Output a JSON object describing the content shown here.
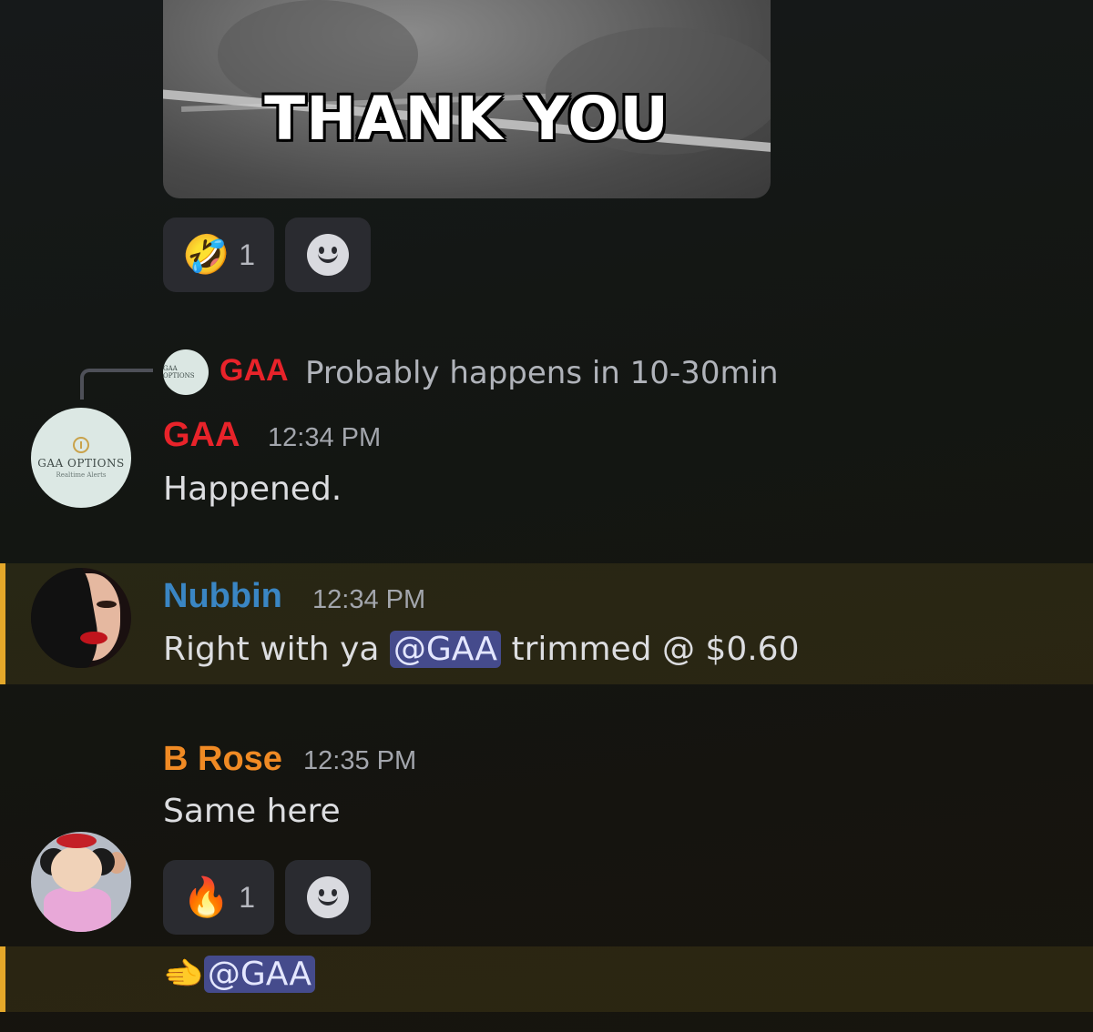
{
  "gif": {
    "caption": "THANK YOU"
  },
  "reactions_1": [
    {
      "emoji": "🤣",
      "count": "1"
    },
    {
      "type": "add-reaction"
    }
  ],
  "reply": {
    "avatar_text": "GAA OPTIONS",
    "author": "GAA",
    "text": "Probably happens in 10-30min"
  },
  "messages": [
    {
      "author": "GAA",
      "author_color": "#e8232a",
      "time": "12:34 PM",
      "text": "Happened.",
      "avatar": {
        "title": "GAA OPTIONS",
        "subtitle": "Realtime Alerts"
      }
    },
    {
      "author": "Nubbin",
      "author_color": "#3a86c4",
      "time": "12:34 PM",
      "text_before": "Right with ya ",
      "mention": "@GAA",
      "text_after": " trimmed @ $0.60",
      "highlighted": true
    },
    {
      "author": "B Rose",
      "author_color": "#f08a24",
      "time": "12:35 PM",
      "text": "Same here"
    }
  ],
  "reactions_2": [
    {
      "emoji": "🔥",
      "count": "1"
    },
    {
      "type": "add-reaction"
    }
  ],
  "last_line": {
    "emoji": "🫲",
    "mention": "@GAA"
  }
}
